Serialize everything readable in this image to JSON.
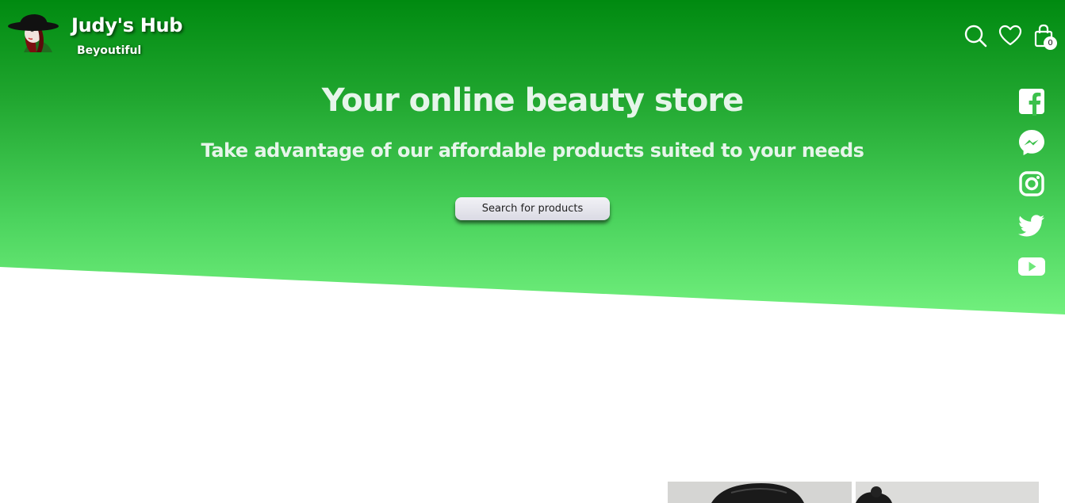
{
  "brand": {
    "title": "Judy's Hub",
    "tagline": "Beyoutiful"
  },
  "header": {
    "icons": [
      "search-icon",
      "heart-icon",
      "shopping-bag-icon"
    ],
    "cart_count": "0"
  },
  "hero": {
    "headline": "Your online beauty store",
    "subheadline": "Take advantage of our affordable products suited to your needs",
    "cta_label": "Search for products"
  },
  "social": [
    "facebook-icon",
    "messenger-icon",
    "instagram-icon",
    "twitter-icon",
    "youtube-icon"
  ],
  "colors": {
    "hero_top": "#008a10",
    "hero_bottom": "#72f07e",
    "text_light": "#e6f5ea",
    "button_bg": "#e6e6ee"
  }
}
